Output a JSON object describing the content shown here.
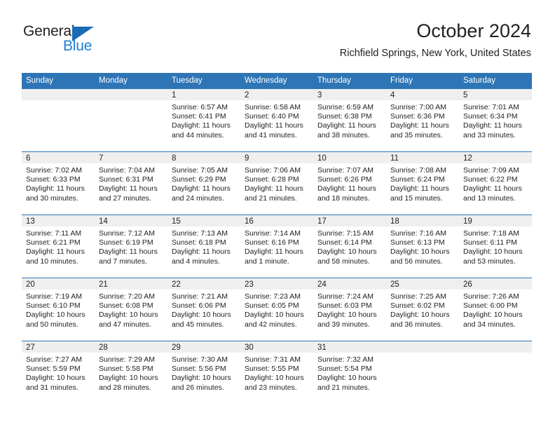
{
  "brand": {
    "name_part1": "General",
    "name_part2": "Blue",
    "triangle_icon": "triangle-icon",
    "accent_color": "#1b7fd4",
    "dark_color": "#231f20"
  },
  "header": {
    "title": "October 2024",
    "subtitle": "Richfield Springs, New York, United States"
  },
  "calendar": {
    "header_color": "#2e75b6",
    "daynum_strip_color": "#efefef",
    "weekday_headers": [
      "Sunday",
      "Monday",
      "Tuesday",
      "Wednesday",
      "Thursday",
      "Friday",
      "Saturday"
    ],
    "weeks": [
      [
        {
          "day": "",
          "sunrise": "",
          "sunset": "",
          "daylight_line1": "",
          "daylight_line2": "",
          "empty": true
        },
        {
          "day": "",
          "sunrise": "",
          "sunset": "",
          "daylight_line1": "",
          "daylight_line2": "",
          "empty": true
        },
        {
          "day": "1",
          "sunrise": "Sunrise: 6:57 AM",
          "sunset": "Sunset: 6:41 PM",
          "daylight_line1": "Daylight: 11 hours",
          "daylight_line2": "and 44 minutes.",
          "empty": false
        },
        {
          "day": "2",
          "sunrise": "Sunrise: 6:58 AM",
          "sunset": "Sunset: 6:40 PM",
          "daylight_line1": "Daylight: 11 hours",
          "daylight_line2": "and 41 minutes.",
          "empty": false
        },
        {
          "day": "3",
          "sunrise": "Sunrise: 6:59 AM",
          "sunset": "Sunset: 6:38 PM",
          "daylight_line1": "Daylight: 11 hours",
          "daylight_line2": "and 38 minutes.",
          "empty": false
        },
        {
          "day": "4",
          "sunrise": "Sunrise: 7:00 AM",
          "sunset": "Sunset: 6:36 PM",
          "daylight_line1": "Daylight: 11 hours",
          "daylight_line2": "and 35 minutes.",
          "empty": false
        },
        {
          "day": "5",
          "sunrise": "Sunrise: 7:01 AM",
          "sunset": "Sunset: 6:34 PM",
          "daylight_line1": "Daylight: 11 hours",
          "daylight_line2": "and 33 minutes.",
          "empty": false
        }
      ],
      [
        {
          "day": "6",
          "sunrise": "Sunrise: 7:02 AM",
          "sunset": "Sunset: 6:33 PM",
          "daylight_line1": "Daylight: 11 hours",
          "daylight_line2": "and 30 minutes.",
          "empty": false
        },
        {
          "day": "7",
          "sunrise": "Sunrise: 7:04 AM",
          "sunset": "Sunset: 6:31 PM",
          "daylight_line1": "Daylight: 11 hours",
          "daylight_line2": "and 27 minutes.",
          "empty": false
        },
        {
          "day": "8",
          "sunrise": "Sunrise: 7:05 AM",
          "sunset": "Sunset: 6:29 PM",
          "daylight_line1": "Daylight: 11 hours",
          "daylight_line2": "and 24 minutes.",
          "empty": false
        },
        {
          "day": "9",
          "sunrise": "Sunrise: 7:06 AM",
          "sunset": "Sunset: 6:28 PM",
          "daylight_line1": "Daylight: 11 hours",
          "daylight_line2": "and 21 minutes.",
          "empty": false
        },
        {
          "day": "10",
          "sunrise": "Sunrise: 7:07 AM",
          "sunset": "Sunset: 6:26 PM",
          "daylight_line1": "Daylight: 11 hours",
          "daylight_line2": "and 18 minutes.",
          "empty": false
        },
        {
          "day": "11",
          "sunrise": "Sunrise: 7:08 AM",
          "sunset": "Sunset: 6:24 PM",
          "daylight_line1": "Daylight: 11 hours",
          "daylight_line2": "and 15 minutes.",
          "empty": false
        },
        {
          "day": "12",
          "sunrise": "Sunrise: 7:09 AM",
          "sunset": "Sunset: 6:22 PM",
          "daylight_line1": "Daylight: 11 hours",
          "daylight_line2": "and 13 minutes.",
          "empty": false
        }
      ],
      [
        {
          "day": "13",
          "sunrise": "Sunrise: 7:11 AM",
          "sunset": "Sunset: 6:21 PM",
          "daylight_line1": "Daylight: 11 hours",
          "daylight_line2": "and 10 minutes.",
          "empty": false
        },
        {
          "day": "14",
          "sunrise": "Sunrise: 7:12 AM",
          "sunset": "Sunset: 6:19 PM",
          "daylight_line1": "Daylight: 11 hours",
          "daylight_line2": "and 7 minutes.",
          "empty": false
        },
        {
          "day": "15",
          "sunrise": "Sunrise: 7:13 AM",
          "sunset": "Sunset: 6:18 PM",
          "daylight_line1": "Daylight: 11 hours",
          "daylight_line2": "and 4 minutes.",
          "empty": false
        },
        {
          "day": "16",
          "sunrise": "Sunrise: 7:14 AM",
          "sunset": "Sunset: 6:16 PM",
          "daylight_line1": "Daylight: 11 hours",
          "daylight_line2": "and 1 minute.",
          "empty": false
        },
        {
          "day": "17",
          "sunrise": "Sunrise: 7:15 AM",
          "sunset": "Sunset: 6:14 PM",
          "daylight_line1": "Daylight: 10 hours",
          "daylight_line2": "and 58 minutes.",
          "empty": false
        },
        {
          "day": "18",
          "sunrise": "Sunrise: 7:16 AM",
          "sunset": "Sunset: 6:13 PM",
          "daylight_line1": "Daylight: 10 hours",
          "daylight_line2": "and 56 minutes.",
          "empty": false
        },
        {
          "day": "19",
          "sunrise": "Sunrise: 7:18 AM",
          "sunset": "Sunset: 6:11 PM",
          "daylight_line1": "Daylight: 10 hours",
          "daylight_line2": "and 53 minutes.",
          "empty": false
        }
      ],
      [
        {
          "day": "20",
          "sunrise": "Sunrise: 7:19 AM",
          "sunset": "Sunset: 6:10 PM",
          "daylight_line1": "Daylight: 10 hours",
          "daylight_line2": "and 50 minutes.",
          "empty": false
        },
        {
          "day": "21",
          "sunrise": "Sunrise: 7:20 AM",
          "sunset": "Sunset: 6:08 PM",
          "daylight_line1": "Daylight: 10 hours",
          "daylight_line2": "and 47 minutes.",
          "empty": false
        },
        {
          "day": "22",
          "sunrise": "Sunrise: 7:21 AM",
          "sunset": "Sunset: 6:06 PM",
          "daylight_line1": "Daylight: 10 hours",
          "daylight_line2": "and 45 minutes.",
          "empty": false
        },
        {
          "day": "23",
          "sunrise": "Sunrise: 7:23 AM",
          "sunset": "Sunset: 6:05 PM",
          "daylight_line1": "Daylight: 10 hours",
          "daylight_line2": "and 42 minutes.",
          "empty": false
        },
        {
          "day": "24",
          "sunrise": "Sunrise: 7:24 AM",
          "sunset": "Sunset: 6:03 PM",
          "daylight_line1": "Daylight: 10 hours",
          "daylight_line2": "and 39 minutes.",
          "empty": false
        },
        {
          "day": "25",
          "sunrise": "Sunrise: 7:25 AM",
          "sunset": "Sunset: 6:02 PM",
          "daylight_line1": "Daylight: 10 hours",
          "daylight_line2": "and 36 minutes.",
          "empty": false
        },
        {
          "day": "26",
          "sunrise": "Sunrise: 7:26 AM",
          "sunset": "Sunset: 6:00 PM",
          "daylight_line1": "Daylight: 10 hours",
          "daylight_line2": "and 34 minutes.",
          "empty": false
        }
      ],
      [
        {
          "day": "27",
          "sunrise": "Sunrise: 7:27 AM",
          "sunset": "Sunset: 5:59 PM",
          "daylight_line1": "Daylight: 10 hours",
          "daylight_line2": "and 31 minutes.",
          "empty": false
        },
        {
          "day": "28",
          "sunrise": "Sunrise: 7:29 AM",
          "sunset": "Sunset: 5:58 PM",
          "daylight_line1": "Daylight: 10 hours",
          "daylight_line2": "and 28 minutes.",
          "empty": false
        },
        {
          "day": "29",
          "sunrise": "Sunrise: 7:30 AM",
          "sunset": "Sunset: 5:56 PM",
          "daylight_line1": "Daylight: 10 hours",
          "daylight_line2": "and 26 minutes.",
          "empty": false
        },
        {
          "day": "30",
          "sunrise": "Sunrise: 7:31 AM",
          "sunset": "Sunset: 5:55 PM",
          "daylight_line1": "Daylight: 10 hours",
          "daylight_line2": "and 23 minutes.",
          "empty": false
        },
        {
          "day": "31",
          "sunrise": "Sunrise: 7:32 AM",
          "sunset": "Sunset: 5:54 PM",
          "daylight_line1": "Daylight: 10 hours",
          "daylight_line2": "and 21 minutes.",
          "empty": false
        },
        {
          "day": "",
          "sunrise": "",
          "sunset": "",
          "daylight_line1": "",
          "daylight_line2": "",
          "empty": true
        },
        {
          "day": "",
          "sunrise": "",
          "sunset": "",
          "daylight_line1": "",
          "daylight_line2": "",
          "empty": true
        }
      ]
    ]
  }
}
